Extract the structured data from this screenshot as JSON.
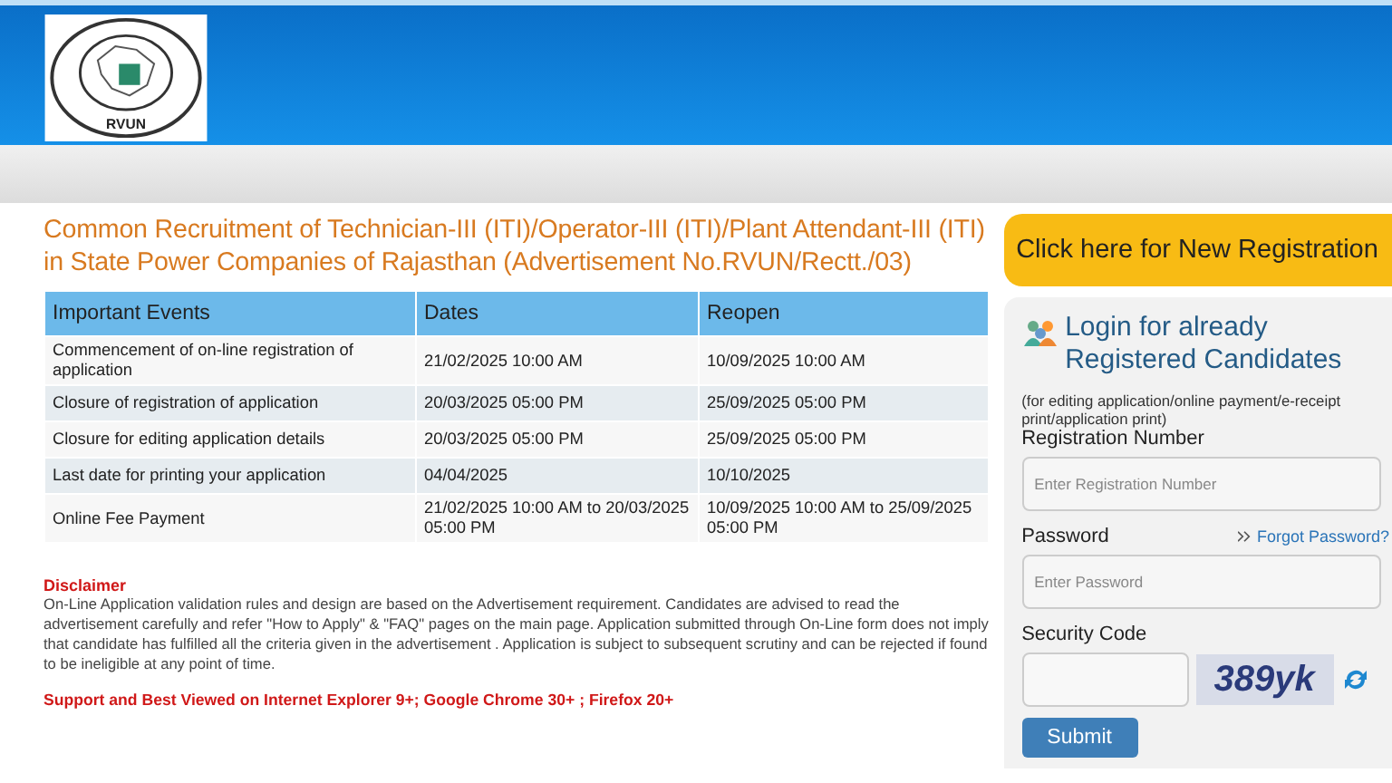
{
  "header": {
    "logo_text": "RVUN"
  },
  "title": "Common Recruitment of Technician-III (ITI)/Operator-III (ITI)/Plant Attendant-III (ITI) in State Power Companies of Rajasthan (Advertisement No.RVUN/Rectt./03)",
  "table": {
    "columns": [
      "Important Events",
      "Dates",
      "Reopen"
    ],
    "rows": [
      [
        "Commencement of on-line registration of application",
        "21/02/2025 10:00 AM",
        "10/09/2025 10:00 AM"
      ],
      [
        "Closure of registration of application",
        "20/03/2025 05:00 PM",
        "25/09/2025 05:00 PM"
      ],
      [
        "Closure for editing application details",
        "20/03/2025 05:00 PM",
        "25/09/2025 05:00 PM"
      ],
      [
        "Last date for printing your application",
        "04/04/2025",
        "10/10/2025"
      ],
      [
        "Online Fee Payment",
        "21/02/2025 10:00 AM to 20/03/2025 05:00 PM",
        "10/09/2025 10:00 AM to 25/09/2025 05:00 PM"
      ]
    ]
  },
  "disclaimer": {
    "heading": "Disclaimer",
    "text": "On-Line Application validation rules and design are based on the Advertisement requirement. Candidates are advised to read the advertisement carefully and refer \"How to Apply\" & \"FAQ\" pages on the main page. Application submitted through On-Line form does not imply that candidate has fulfilled all the criteria given in the advertisement . Application is subject to subsequent scrutiny and can be rejected if found to be ineligible at any point of time."
  },
  "support_note": "Support and Best Viewed on Internet Explorer 9+; Google Chrome 30+ ; Firefox 20+",
  "new_registration_button": "Click here for New Registration",
  "login": {
    "heading": "Login for already Registered Candidates",
    "note": "(for editing application/online payment/e-receipt print/application print)",
    "registration_label": "Registration Number",
    "registration_placeholder": "Enter Registration Number",
    "password_label": "Password",
    "forgot_link": "Forgot Password?",
    "password_placeholder": "Enter Password",
    "security_label": "Security Code",
    "captcha": "389yk",
    "submit": "Submit"
  }
}
